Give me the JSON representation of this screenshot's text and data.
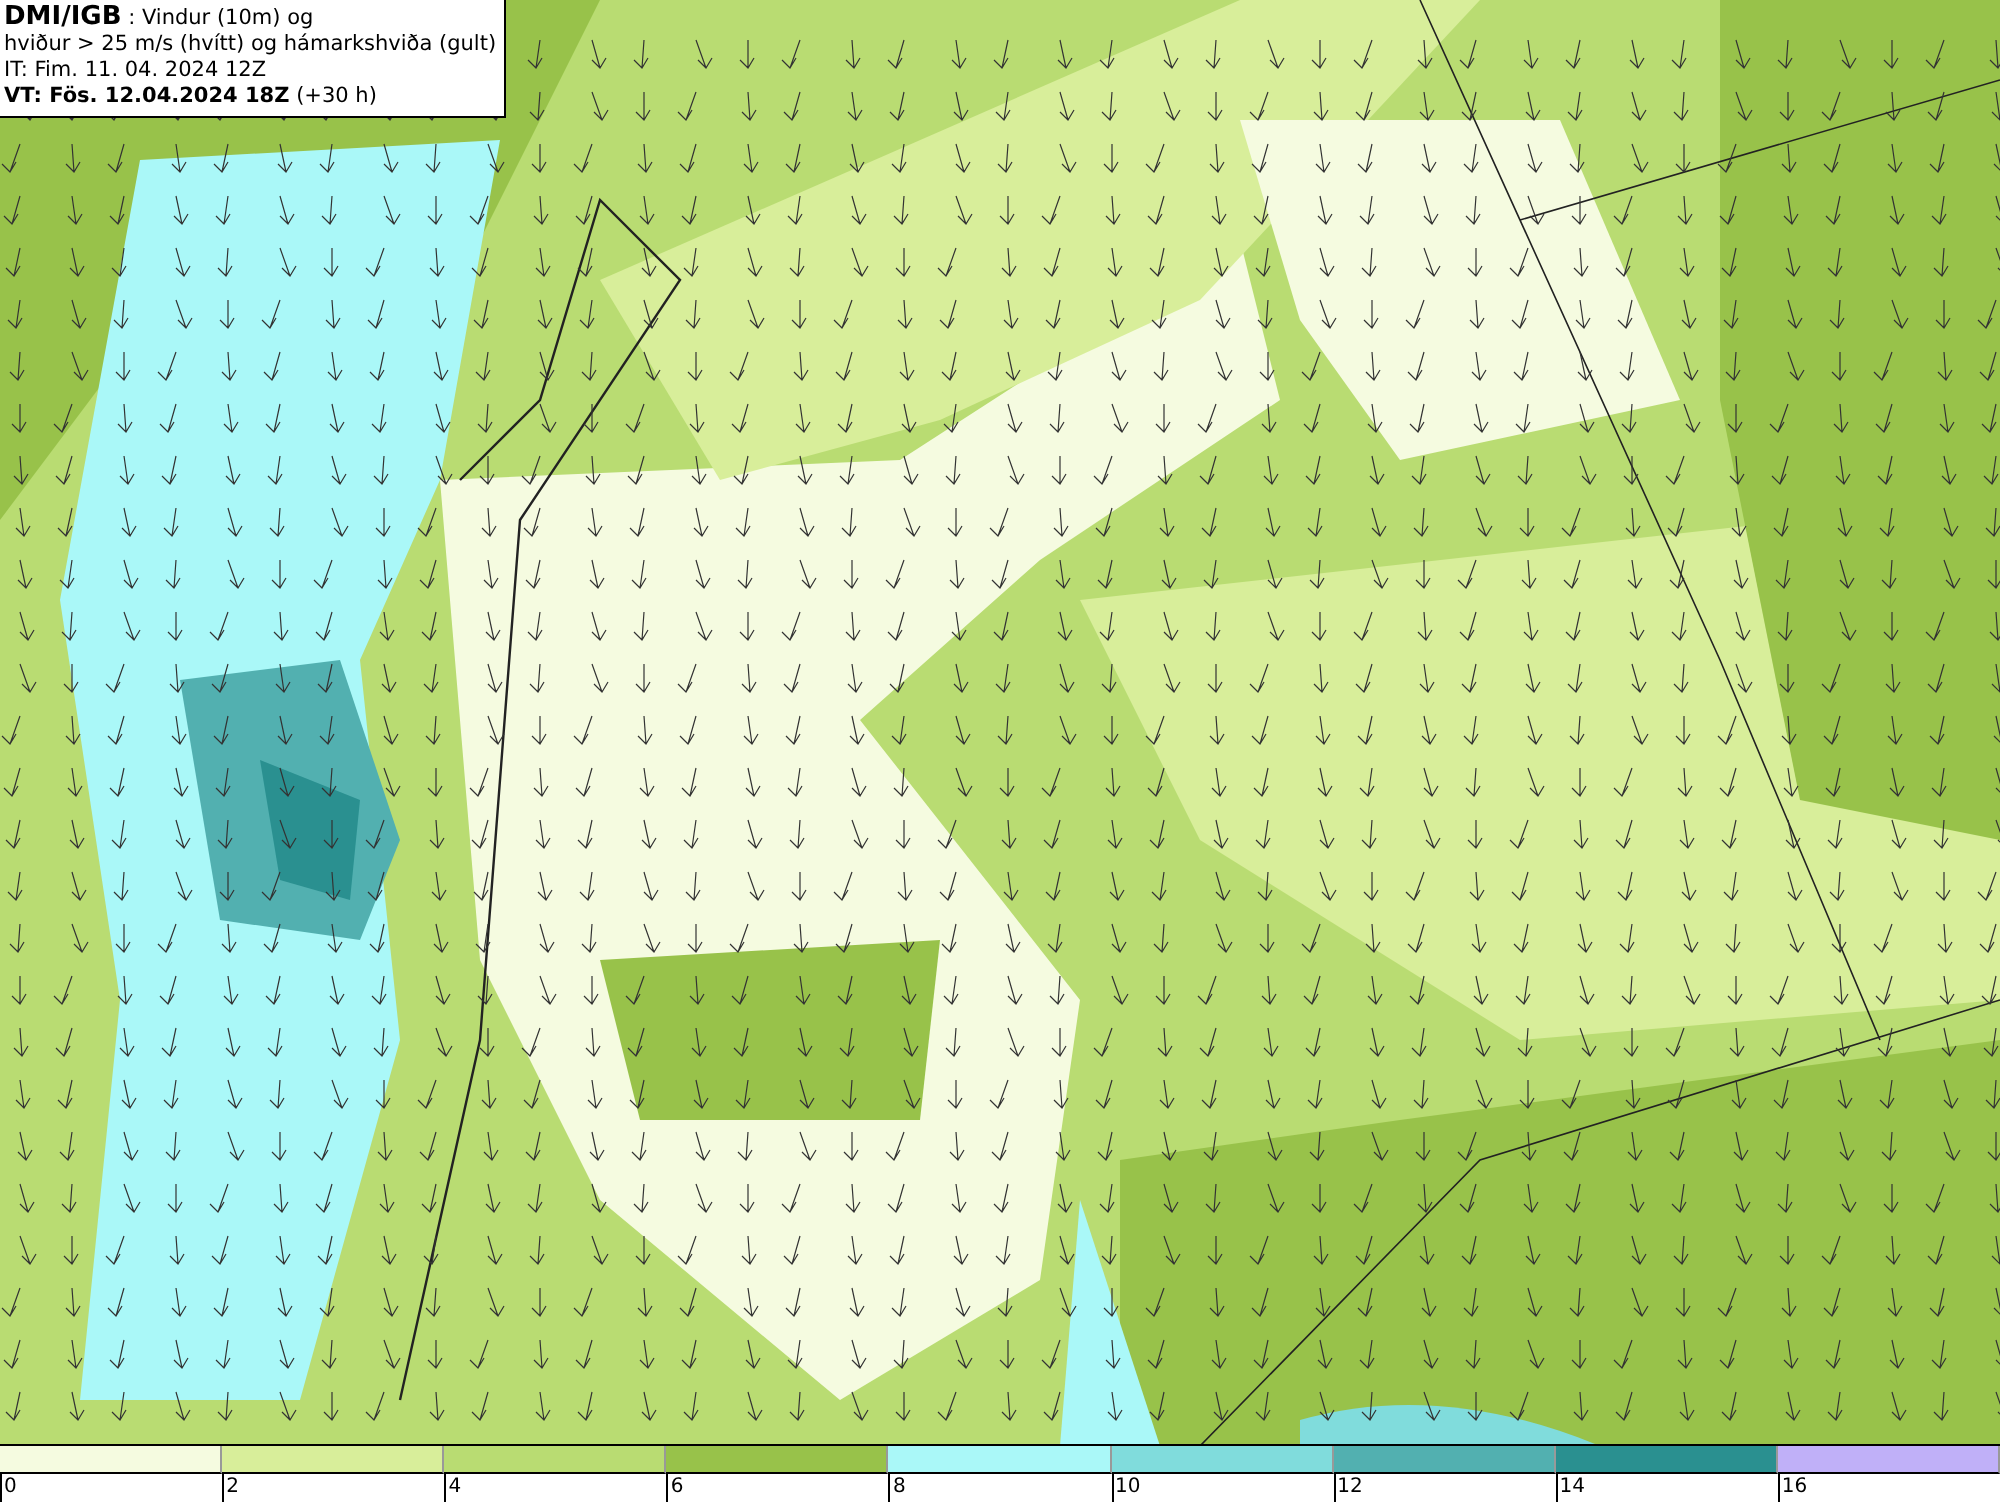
{
  "header": {
    "source": "DMI/IGB",
    "title": ": Vindur (10m) og",
    "subtitle": "hviður > 25 m/s (hvítt) og hámarkshviða (gult)",
    "issue_time": "IT: Fim. 11. 04. 2024 12Z",
    "valid_time": "VT: Fös. 12.04.2024 18Z",
    "lead_time": "(+30 h)"
  },
  "legend": [
    {
      "label": "0",
      "color": "#f5fbe0"
    },
    {
      "label": "2",
      "color": "#d8ee9a"
    },
    {
      "label": "4",
      "color": "#b9dc72"
    },
    {
      "label": "6",
      "color": "#98c24a"
    },
    {
      "label": "8",
      "color": "#aaf8f8"
    },
    {
      "label": "10",
      "color": "#80dcdc"
    },
    {
      "label": "12",
      "color": "#52b0b0"
    },
    {
      "label": "14",
      "color": "#2a9090"
    },
    {
      "label": "16",
      "color": "#c0b0f8"
    }
  ]
}
